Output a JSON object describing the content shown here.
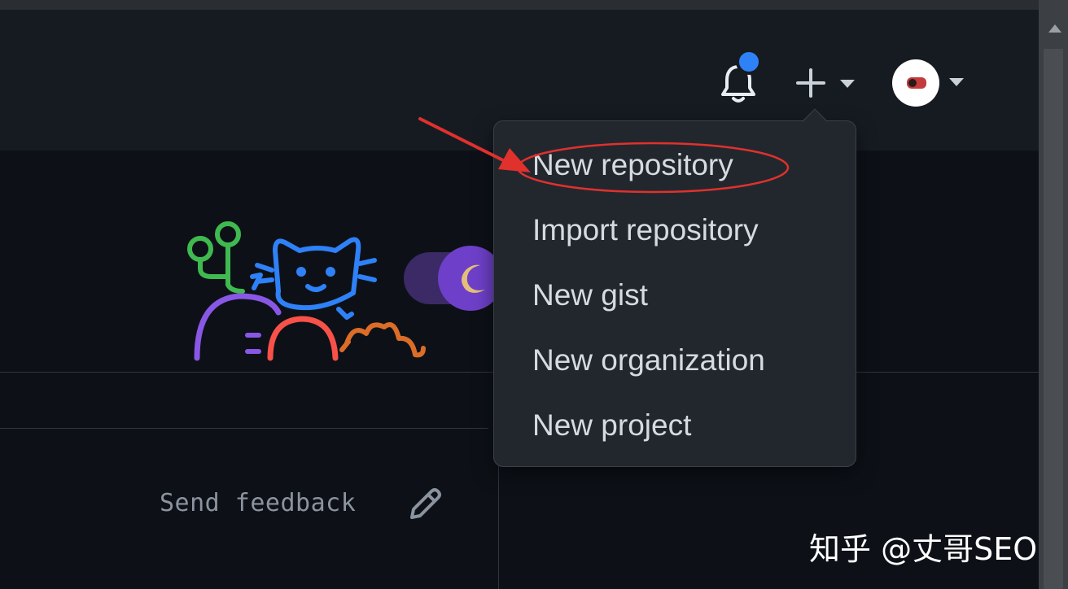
{
  "header": {
    "notifications_icon": "bell-icon",
    "create_icon": "plus-icon",
    "avatar_icon": "avatar",
    "unread_indicator_color": "#2f81f7"
  },
  "menu": {
    "items": [
      {
        "label": "New repository"
      },
      {
        "label": "Import repository"
      },
      {
        "label": "New gist"
      },
      {
        "label": "New organization"
      },
      {
        "label": "New project"
      }
    ]
  },
  "feedback": {
    "label": "Send feedback",
    "icon": "pencil-icon"
  },
  "annotation": {
    "arrow_color": "#e0312d",
    "highlight": "ellipse"
  },
  "watermark": {
    "text": "知乎 @丈哥SEO"
  },
  "theme": {
    "background": "#0d1117",
    "header_bg": "#161b22",
    "menu_bg": "#22272e"
  }
}
